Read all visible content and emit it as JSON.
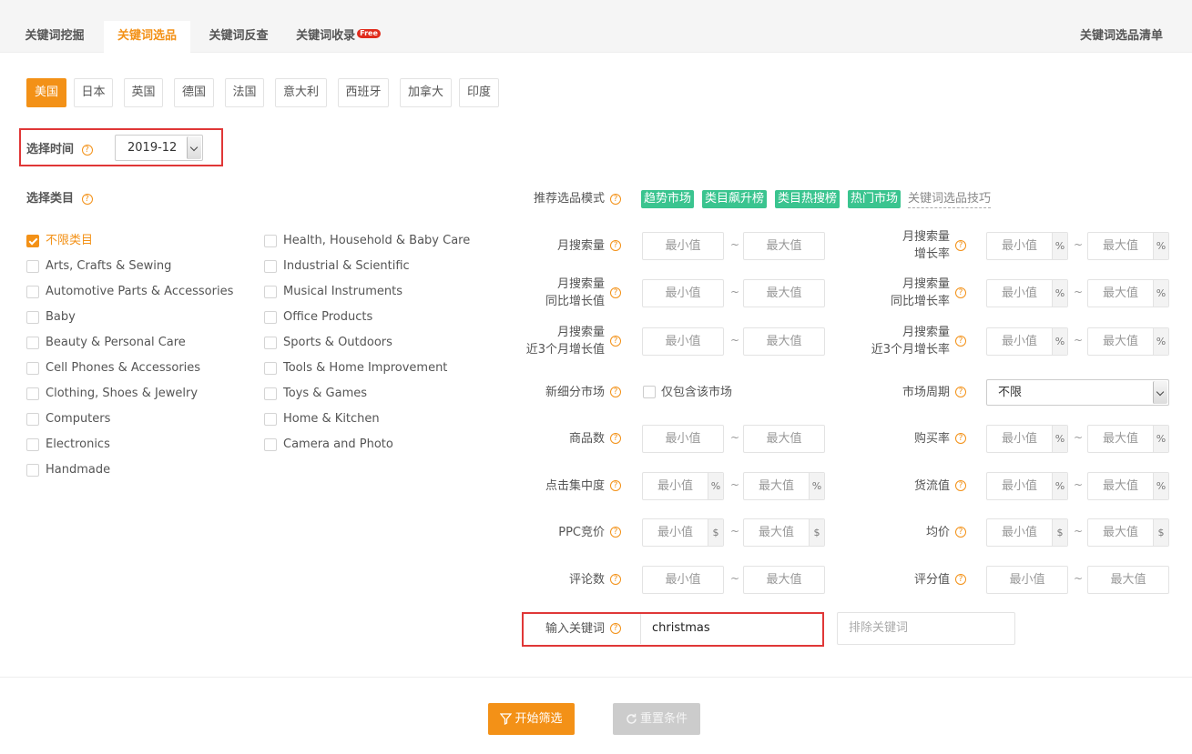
{
  "tabs": [
    {
      "label": "关键词挖掘"
    },
    {
      "label": "关键词选品"
    },
    {
      "label": "关键词反查"
    },
    {
      "label": "关键词收录",
      "badge": "Free"
    }
  ],
  "tab_right": "关键词选品清单",
  "countries": [
    "美国",
    "日本",
    "英国",
    "德国",
    "法国",
    "意大利",
    "西班牙",
    "加拿大",
    "印度"
  ],
  "time": {
    "label": "选择时间",
    "value": "2019-12"
  },
  "category": {
    "label": "选择类目",
    "items": [
      "不限类目",
      "Arts, Crafts & Sewing",
      "Automotive Parts & Accessories",
      "Baby",
      "Beauty & Personal Care",
      "Cell Phones & Accessories",
      "Clothing, Shoes & Jewelry",
      "Computers",
      "Electronics",
      "Handmade",
      "Health, Household & Baby Care",
      "Industrial & Scientific",
      "Musical Instruments",
      "Office Products",
      "Sports & Outdoors",
      "Tools & Home Improvement",
      "Toys & Games",
      "Home & Kitchen",
      "Camera and Photo"
    ]
  },
  "mode": {
    "label": "推荐选品模式",
    "tags": [
      "趋势市场",
      "类目飙升榜",
      "类目热搜榜",
      "热门市场"
    ],
    "link": "关键词选品技巧"
  },
  "filters": {
    "monthly_search": {
      "label": "月搜索量"
    },
    "monthly_growth": {
      "label1": "月搜索量",
      "label2": "增长率"
    },
    "yoy_value": {
      "label1": "月搜索量",
      "label2": "同比增长值"
    },
    "yoy_rate": {
      "label1": "月搜索量",
      "label2": "同比增长率"
    },
    "m3_value": {
      "label1": "月搜索量",
      "label2": "近3个月增长值"
    },
    "m3_rate": {
      "label1": "月搜索量",
      "label2": "近3个月增长率"
    },
    "new_market": {
      "label": "新细分市场",
      "option": "仅包含该市场"
    },
    "cycle": {
      "label": "市场周期",
      "value": "不限"
    },
    "products": {
      "label": "商品数"
    },
    "buy_rate": {
      "label": "购买率"
    },
    "click_conc": {
      "label": "点击集中度"
    },
    "gmv": {
      "label": "货流值"
    },
    "ppc": {
      "label": "PPC竞价"
    },
    "avg_price": {
      "label": "均价"
    },
    "reviews": {
      "label": "评论数"
    },
    "rating": {
      "label": "评分值"
    }
  },
  "placeholders": {
    "min": "最小值",
    "max": "最大值",
    "tilde": "~",
    "pct": "%",
    "usd": "$"
  },
  "keyword": {
    "label": "输入关键词",
    "value": "christmas",
    "exclude_placeholder": "排除关键词"
  },
  "buttons": {
    "start": "开始筛选",
    "reset": "重置条件"
  },
  "colors": {
    "accent": "#f39117",
    "tag": "#3ac48f",
    "highlight": "#e03737"
  }
}
